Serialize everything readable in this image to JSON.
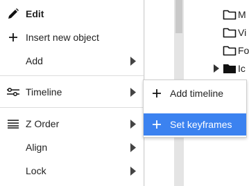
{
  "menu": {
    "edit": {
      "label": "Edit",
      "icon": "pencil-icon"
    },
    "insert": {
      "label": "Insert new object",
      "icon": "plus-icon"
    },
    "add": {
      "label": "Add",
      "icon": "chevron-right-icon"
    },
    "timeline": {
      "label": "Timeline",
      "icon": "timeline-icon"
    },
    "zorder": {
      "label": "Z Order",
      "icon": "lines-icon"
    },
    "align": {
      "label": "Align"
    },
    "lock": {
      "label": "Lock"
    }
  },
  "submenu": {
    "add_timeline": {
      "label": "Add timeline",
      "icon": "plus-icon"
    },
    "set_keyframes": {
      "label": "Set keyframes",
      "icon": "plus-icon",
      "highlighted": true
    }
  },
  "tree": [
    {
      "label": "M",
      "icon": "folder-outline-icon"
    },
    {
      "label": "Vi",
      "icon": "folder-outline-icon"
    },
    {
      "label": "Fo",
      "icon": "folder-outline-icon"
    },
    {
      "label": "Ic",
      "icon": "folder-filled-icon",
      "expandable": true
    }
  ],
  "colors": {
    "highlight": "#3b82f0"
  }
}
